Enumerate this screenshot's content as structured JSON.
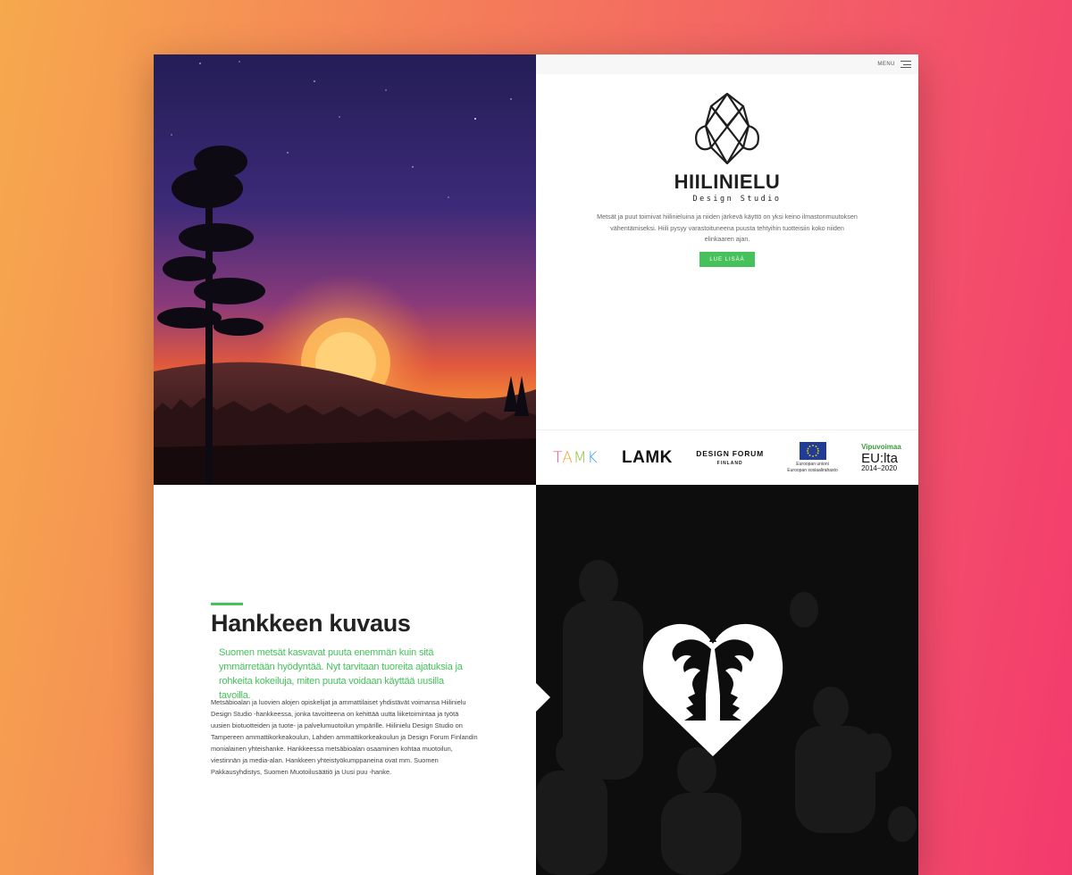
{
  "header": {
    "menu_label": "MENU"
  },
  "hero": {
    "brand": "HIILINIELU",
    "subbrand": "Design Studio",
    "intro": "Metsät ja puut toimivat hiilinieluina ja niiden järkevä käyttö on yksi keino ilmastonmuutoksen vähentämiseksi. Hiili pysyy varastoituneena puusta tehtyihin tuotteisiin koko niiden elinkaaren ajan.",
    "cta_label": "LUE LISÄÄ"
  },
  "partners": {
    "tamk": [
      "T",
      "A",
      "M",
      "K"
    ],
    "lamk": "LAMK",
    "design_forum": {
      "name": "DESIGN FORUM",
      "country": "FINLAND"
    },
    "eu": {
      "line1": "Euroopan unioni",
      "line2": "Euroopan sosiaalirahasto"
    },
    "vipuvoimaa": {
      "title": "Vipuvoimaa",
      "eu": "EU:lta",
      "years": "2014–2020"
    }
  },
  "project": {
    "heading": "Hankkeen kuvaus",
    "lede": "Suomen metsät kasvavat puuta enemmän kuin sitä ymmärretään hyödyntää. Nyt tarvitaan tuoreita ajatuksia ja rohkeita kokeiluja, miten puuta voidaan käyttää uusilla tavoilla.",
    "body": "Metsäbioalan ja luovien alojen opiskelijat ja ammattilaiset yhdistävät voimansa Hiilinielu Design Studio -hankkeessa, jonka tavoitteena on kehittää uutta liiketoimintaa ja työtä uusien biotuotteiden ja tuote- ja palvelumuotoilun ympärille. Hiilinielu Design Studio on Tampereen ammattikorkeakoulun, Lahden ammattikorkeakoulun ja Design Forum Finlandin monialainen yhteishanke. Hankkeessa metsäbioalan osaaminen kohtaa muotoilun, viestinnän ja media-alan. Hankkeen yhteistyökumppaneina ovat mm. Suomen Pakkausyhdistys, Suomen Muotoilusäätiö ja Uusi puu -hanke."
  },
  "colors": {
    "accent": "#47c15c",
    "sky_top": "#2a2160",
    "sun": "#ff9a3c",
    "dark": "#0d0d0d"
  }
}
